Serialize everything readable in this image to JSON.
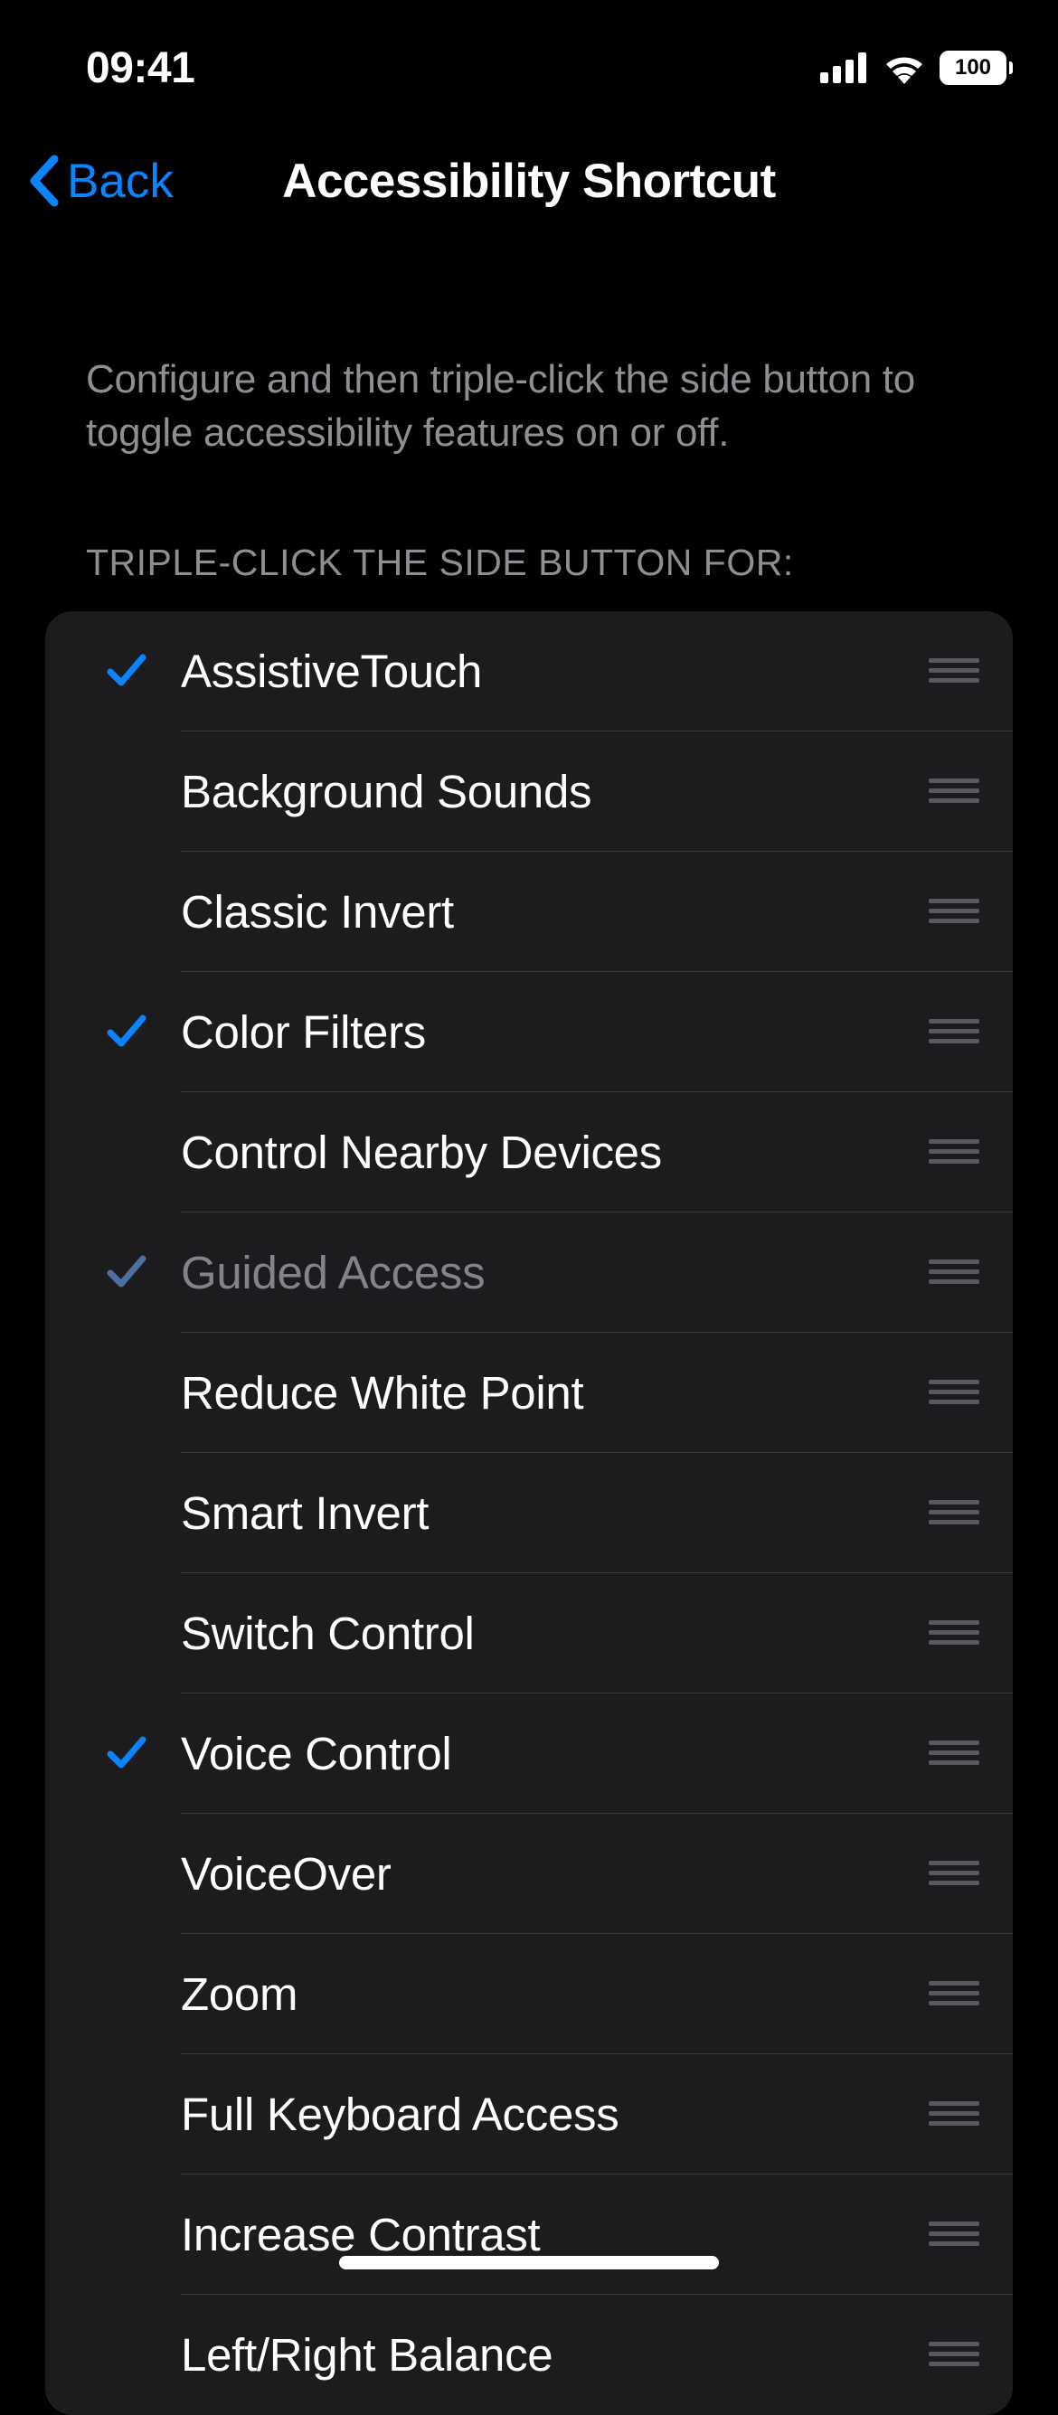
{
  "status": {
    "time": "09:41",
    "battery": "100"
  },
  "nav": {
    "back": "Back",
    "title": "Accessibility Shortcut"
  },
  "description": "Configure and then triple-click the side button to toggle accessibility features on or off.",
  "section_header": "TRIPLE-CLICK THE SIDE BUTTON FOR:",
  "items": [
    {
      "label": "AssistiveTouch",
      "checked": true,
      "dimmed": false
    },
    {
      "label": "Background Sounds",
      "checked": false,
      "dimmed": false
    },
    {
      "label": "Classic Invert",
      "checked": false,
      "dimmed": false
    },
    {
      "label": "Color Filters",
      "checked": true,
      "dimmed": false
    },
    {
      "label": "Control Nearby Devices",
      "checked": false,
      "dimmed": false
    },
    {
      "label": "Guided Access",
      "checked": true,
      "dimmed": true
    },
    {
      "label": "Reduce White Point",
      "checked": false,
      "dimmed": false
    },
    {
      "label": "Smart Invert",
      "checked": false,
      "dimmed": false
    },
    {
      "label": "Switch Control",
      "checked": false,
      "dimmed": false
    },
    {
      "label": "Voice Control",
      "checked": true,
      "dimmed": false
    },
    {
      "label": "VoiceOver",
      "checked": false,
      "dimmed": false
    },
    {
      "label": "Zoom",
      "checked": false,
      "dimmed": false
    },
    {
      "label": "Full Keyboard Access",
      "checked": false,
      "dimmed": false
    },
    {
      "label": "Increase Contrast",
      "checked": false,
      "dimmed": false
    },
    {
      "label": "Left/Right Balance",
      "checked": false,
      "dimmed": false
    }
  ]
}
